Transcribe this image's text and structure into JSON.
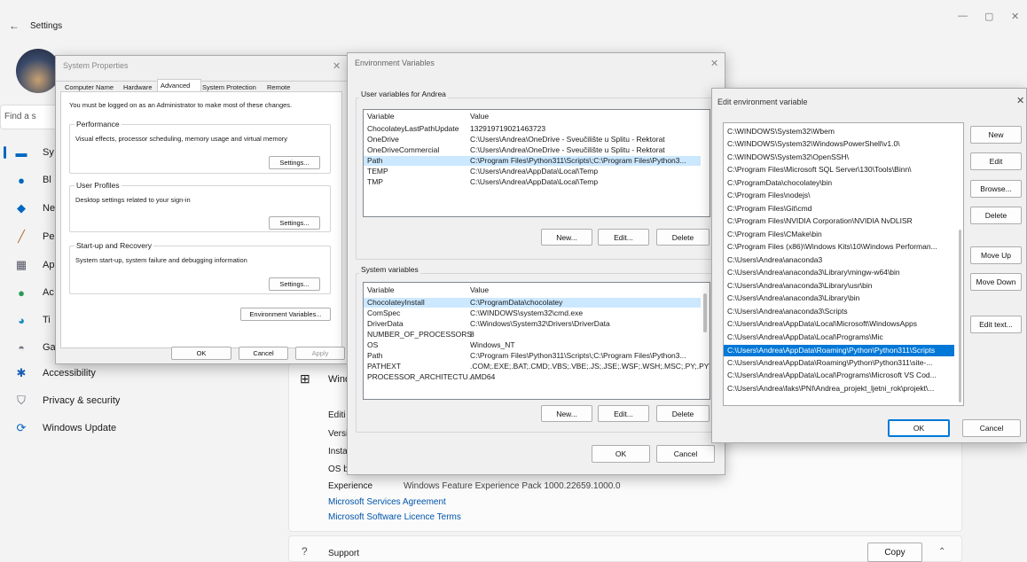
{
  "settings": {
    "title": "Settings",
    "back": "←",
    "search_placeholder": "Find a s",
    "controls": [
      "—",
      "▢",
      "✕"
    ],
    "nav": [
      {
        "label": "Sy",
        "icon": "monitor-icon"
      },
      {
        "label": "Bl",
        "icon": "bluetooth-icon"
      },
      {
        "label": "Ne",
        "icon": "wifi-icon"
      },
      {
        "label": "Pe",
        "icon": "brush-icon"
      },
      {
        "label": "Ap",
        "icon": "apps-icon"
      },
      {
        "label": "Ac",
        "icon": "person-icon"
      },
      {
        "label": "Ti",
        "icon": "globe-icon"
      },
      {
        "label": "Ga",
        "icon": "gamepad-icon"
      },
      {
        "label": "Accessibility",
        "icon": "accessibility-icon"
      },
      {
        "label": "Privacy & security",
        "icon": "shield-icon"
      },
      {
        "label": "Windows Update",
        "icon": "update-icon"
      }
    ],
    "spec_header": "Wind",
    "spec_labels": [
      "Editi",
      "Versi",
      "Insta",
      "OS b"
    ],
    "experience_label": "Experience",
    "experience_value": "Windows Feature Experience Pack 1000.22659.1000.0",
    "links": [
      "Microsoft Services Agreement",
      "Microsoft Software Licence Terms"
    ],
    "support_label": "Support",
    "copy_label": "Copy"
  },
  "sysprops": {
    "title": "System Properties",
    "tabs": [
      "Computer Name",
      "Hardware",
      "Advanced",
      "System Protection",
      "Remote"
    ],
    "admin_note": "You must be logged on as an Administrator to make most of these changes.",
    "performance": {
      "label": "Performance",
      "desc": "Visual effects, processor scheduling, memory usage and virtual memory",
      "button": "Settings..."
    },
    "profiles": {
      "label": "User Profiles",
      "desc": "Desktop settings related to your sign-in",
      "button": "Settings..."
    },
    "startup": {
      "label": "Start-up and Recovery",
      "desc": "System start-up, system failure and debugging information",
      "button": "Settings..."
    },
    "env_button": "Environment Variables...",
    "ok": "OK",
    "cancel": "Cancel",
    "apply": "Apply"
  },
  "envvars": {
    "title": "Environment Variables",
    "user_group": "User variables for Andrea",
    "col_variable": "Variable",
    "col_value": "Value",
    "user_rows": [
      {
        "name": "ChocolateyLastPathUpdate",
        "value": "132919719021463723"
      },
      {
        "name": "OneDrive",
        "value": "C:\\Users\\Andrea\\OneDrive - Sveučilište u Splitu - Rektorat"
      },
      {
        "name": "OneDriveCommercial",
        "value": "C:\\Users\\Andrea\\OneDrive - Sveučilište u Splitu - Rektorat"
      },
      {
        "name": "Path",
        "value": "C:\\Program Files\\Python311\\Scripts\\;C:\\Program Files\\Python3..."
      },
      {
        "name": "TEMP",
        "value": "C:\\Users\\Andrea\\AppData\\Local\\Temp"
      },
      {
        "name": "TMP",
        "value": "C:\\Users\\Andrea\\AppData\\Local\\Temp"
      }
    ],
    "system_group": "System variables",
    "system_rows": [
      {
        "name": "ChocolateyInstall",
        "value": "C:\\ProgramData\\chocolatey"
      },
      {
        "name": "ComSpec",
        "value": "C:\\WINDOWS\\system32\\cmd.exe"
      },
      {
        "name": "DriverData",
        "value": "C:\\Windows\\System32\\Drivers\\DriverData"
      },
      {
        "name": "NUMBER_OF_PROCESSORS",
        "value": "8"
      },
      {
        "name": "OS",
        "value": "Windows_NT"
      },
      {
        "name": "Path",
        "value": "C:\\Program Files\\Python311\\Scripts\\;C:\\Program Files\\Python3..."
      },
      {
        "name": "PATHEXT",
        "value": ".COM;.EXE;.BAT;.CMD;.VBS;.VBE;.JS;.JSE;.WSF;.WSH;.MSC;.PY;.PYW"
      },
      {
        "name": "PROCESSOR_ARCHITECTU...",
        "value": "AMD64"
      }
    ],
    "new": "New...",
    "edit": "Edit...",
    "delete": "Delete",
    "ok": "OK",
    "cancel": "Cancel"
  },
  "editenv": {
    "title": "Edit environment variable",
    "entries": [
      "C:\\WINDOWS\\System32\\Wbem",
      "C:\\WINDOWS\\System32\\WindowsPowerShell\\v1.0\\",
      "C:\\WINDOWS\\System32\\OpenSSH\\",
      "C:\\Program Files\\Microsoft SQL Server\\130\\Tools\\Binn\\",
      "C:\\ProgramData\\chocolatey\\bin",
      "C:\\Program Files\\nodejs\\",
      "C:\\Program Files\\Git\\cmd",
      "C:\\Program Files\\NVIDIA Corporation\\NVIDIA NvDLISR",
      "C:\\Program Files\\CMake\\bin",
      "C:\\Program Files (x86)\\Windows Kits\\10\\Windows Performan...",
      "C:\\Users\\Andrea\\anaconda3",
      "C:\\Users\\Andrea\\anaconda3\\Library\\mingw-w64\\bin",
      "C:\\Users\\Andrea\\anaconda3\\Library\\usr\\bin",
      "C:\\Users\\Andrea\\anaconda3\\Library\\bin",
      "C:\\Users\\Andrea\\anaconda3\\Scripts",
      "C:\\Users\\Andrea\\AppData\\Local\\Microsoft\\WindowsApps",
      "C:\\Users\\Andrea\\AppData\\Local\\Programs\\Mic",
      "C:\\Users\\Andrea\\AppData\\Roaming\\Python\\Python311\\Scripts",
      "C:\\Users\\Andrea\\AppData\\Roaming\\Python\\Python311\\site-...",
      "C:\\Users\\Andrea\\AppData\\Local\\Programs\\Microsoft VS Cod...",
      "C:\\Users\\Andrea\\faks\\PNI\\Andrea_projekt_ljetni_rok\\projekt\\..."
    ],
    "selected_index": 17,
    "buttons": [
      "New",
      "Edit",
      "Browse...",
      "Delete",
      "Move Up",
      "Move Down",
      "Edit text..."
    ],
    "ok": "OK",
    "cancel": "Cancel"
  },
  "colors": {
    "accent": "#0078d7",
    "link": "#0055aa",
    "selection_light": "#cce8ff"
  }
}
